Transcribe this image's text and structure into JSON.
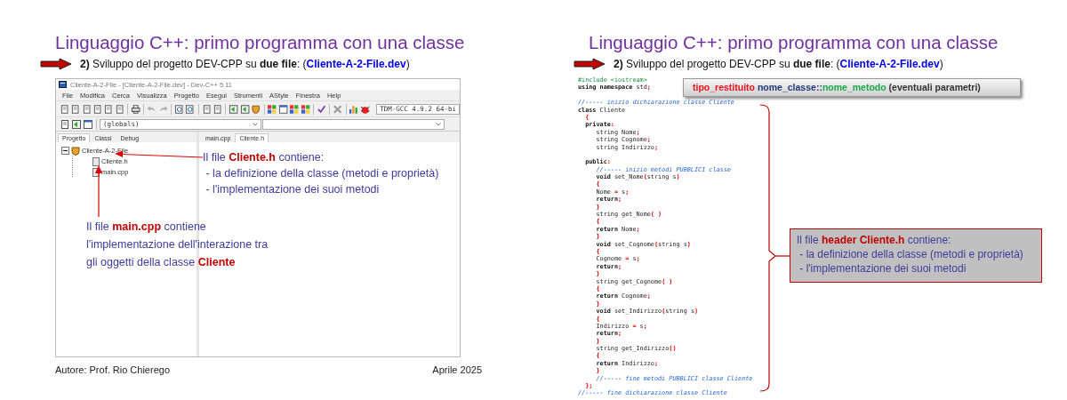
{
  "left_slide": {
    "title": "Linguaggio C++: primo programma con una classe",
    "subtitle": "**2)** Sviluppo del progetto DEV-CPP su **due file**: (**Cliente-A-2-File.dev**)",
    "ide": {
      "window_title": "Cliente-A-2-File - [Cliente-A-2-File.dev] - Dev-C++ 5.11",
      "menu": [
        "File",
        "Modifica",
        "Cerca",
        "Visualizza",
        "Progetto",
        "Esegui",
        "Strumenti",
        "AStyle",
        "Finestra",
        "Help"
      ],
      "compiler": "TDM-GCC 4.9.2 64-bi",
      "scope": "(globals)",
      "panel_tabs": [
        {
          "label": "Progetto",
          "selected": true
        },
        {
          "label": "Classi",
          "selected": false
        },
        {
          "label": "Debug",
          "selected": false
        }
      ],
      "project_tree": [
        {
          "label": "Cliente-A-2-File",
          "expanded": true,
          "children": [
            {
              "label": "Cliente.h"
            },
            {
              "label": "main.cpp"
            }
          ]
        }
      ],
      "editor_tabs": [
        {
          "label": "main.cpp",
          "selected": false
        },
        {
          "label": "Cliente.h",
          "selected": true
        }
      ]
    },
    "annotations": [
      {
        "lines": [
          "Il file **Cliente.h** contiene:",
          " - la definizione della classe (metodi e proprietà)",
          " - l'implementazione dei suoi metodi"
        ]
      },
      {
        "lines": [
          "Il file **main.cpp** contiene",
          "l'implementazione dell'interazione tra",
          "gli oggetti della classe **Cliente**"
        ]
      }
    ],
    "footer": {
      "author": "Autore: Prof. Rio Chierego",
      "date": "Aprile 2025"
    }
  },
  "right_slide": {
    "title": "Linguaggio C++: primo programma con una classe",
    "subtitle": "**2)** Sviluppo del progetto DEV-CPP su **due file**: (**Cliente-A-2-File.dev**)",
    "syntax_box": {
      "words": [
        {
          "segments": [
            {
              "text": "tipo_restituito",
              "color": "#e8141b"
            }
          ]
        },
        {
          "segments": [
            {
              "text": "nome_classe::",
              "color": "#1f3a7a"
            },
            {
              "text": "nome_metodo",
              "color": "#1aa84a"
            }
          ]
        },
        {
          "segments": [
            {
              "text": "(eventuali parametri)",
              "color": "#333333"
            }
          ]
        }
      ]
    },
    "code": [
      {
        "kind": "directive",
        "text": "#include <iostream>"
      },
      {
        "kind": "code",
        "text": "**using namespace** std;"
      },
      {
        "kind": "blank"
      },
      {
        "kind": "comment",
        "text": "//----- inizio dichiarazione classe Cliente"
      },
      {
        "kind": "code",
        "text": "**class** Cliente"
      },
      {
        "kind": "code",
        "text": "  {"
      },
      {
        "kind": "code",
        "text": "  **private**:"
      },
      {
        "kind": "code",
        "text": "     string Nome;"
      },
      {
        "kind": "code",
        "text": "     string Cognome;"
      },
      {
        "kind": "code",
        "text": "     string Indirizzo;"
      },
      {
        "kind": "blank"
      },
      {
        "kind": "code",
        "text": "  **public**:"
      },
      {
        "kind": "comment",
        "text": "     //----- inizio metodi PUBBLICI classe"
      },
      {
        "kind": "code",
        "text": "     **void** set_Nome(string s)"
      },
      {
        "kind": "code",
        "text": "     {"
      },
      {
        "kind": "code",
        "text": "     Nome = s;"
      },
      {
        "kind": "code",
        "text": "     **return**;"
      },
      {
        "kind": "code",
        "text": "     }"
      },
      {
        "kind": "code",
        "text": "     string get_Nome( )"
      },
      {
        "kind": "code",
        "text": "     {"
      },
      {
        "kind": "code",
        "text": "     **return** Nome;"
      },
      {
        "kind": "code",
        "text": "     }"
      },
      {
        "kind": "code",
        "text": "     **void** set_Cognome(string s)"
      },
      {
        "kind": "code",
        "text": "     {"
      },
      {
        "kind": "code",
        "text": "     Cognome = s;"
      },
      {
        "kind": "code",
        "text": "     **return**;"
      },
      {
        "kind": "code",
        "text": "     }"
      },
      {
        "kind": "code",
        "text": "     string get_Cognome( )"
      },
      {
        "kind": "code",
        "text": "     {"
      },
      {
        "kind": "code",
        "text": "     **return** Cognome;"
      },
      {
        "kind": "code",
        "text": "     }"
      },
      {
        "kind": "code",
        "text": "     **void** set_Indirizzo(string s)"
      },
      {
        "kind": "code",
        "text": "     {"
      },
      {
        "kind": "code",
        "text": "     Indirizzo = s;"
      },
      {
        "kind": "code",
        "text": "     **return**;"
      },
      {
        "kind": "code",
        "text": "     }"
      },
      {
        "kind": "code",
        "text": "     string get_Indirizzo()"
      },
      {
        "kind": "code",
        "text": "     {"
      },
      {
        "kind": "code",
        "text": "     **return** Indirizzo;"
      },
      {
        "kind": "code",
        "text": "     }"
      },
      {
        "kind": "comment",
        "text": "     //----- fine metodi PUBBLICI classe Cliente"
      },
      {
        "kind": "code",
        "text": "  };"
      },
      {
        "kind": "comment",
        "text": "//----- fine dichiarazione classe Cliente"
      }
    ],
    "note": {
      "lines": [
        "Il file **header Cliente.h** contiene:",
        " - la definizione della classe (metodi e proprietà)",
        " - l'implementazione dei suoi metodi"
      ]
    }
  }
}
